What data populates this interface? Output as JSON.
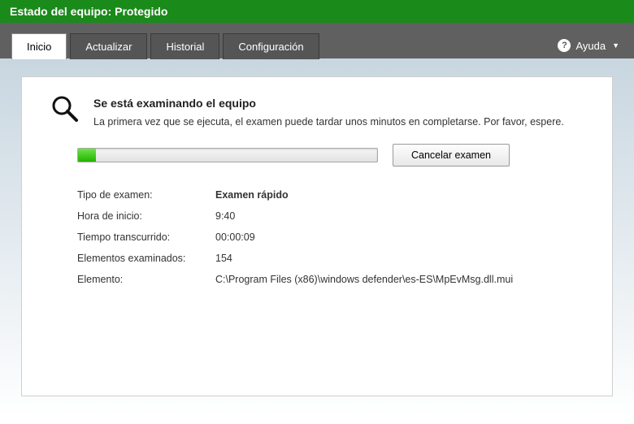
{
  "header": {
    "status_label": "Estado del equipo:",
    "status_value": "Protegido"
  },
  "tabs": [
    {
      "label": "Inicio",
      "active": true
    },
    {
      "label": "Actualizar",
      "active": false
    },
    {
      "label": "Historial",
      "active": false
    },
    {
      "label": "Configuración",
      "active": false
    }
  ],
  "help": {
    "label": "Ayuda"
  },
  "scan": {
    "title": "Se está examinando el equipo",
    "desc": "La primera vez que se ejecuta, el examen puede tardar unos minutos en completarse. Por favor, espere.",
    "cancel_label": "Cancelar examen",
    "progress_percent": 6
  },
  "details": {
    "type_label": "Tipo de examen:",
    "type_value": "Examen rápido",
    "start_label": "Hora de inicio:",
    "start_value": "9:40",
    "elapsed_label": "Tiempo transcurrido:",
    "elapsed_value": "00:00:09",
    "items_label": "Elementos examinados:",
    "items_value": "154",
    "element_label": "Elemento:",
    "element_value": "C:\\Program Files (x86)\\windows defender\\es-ES\\MpEvMsg.dll.mui"
  }
}
